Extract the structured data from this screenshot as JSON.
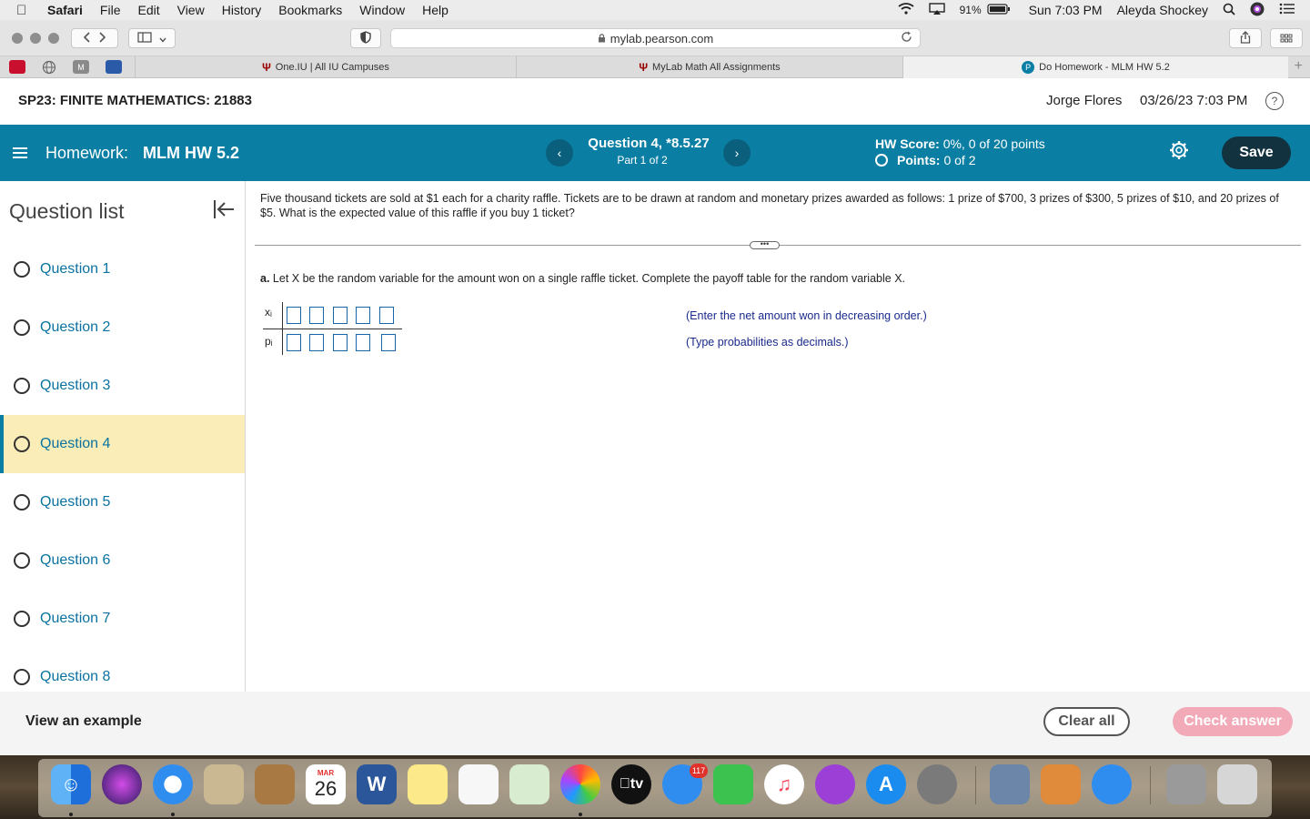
{
  "menubar": {
    "apple": "",
    "items": [
      "Safari",
      "File",
      "Edit",
      "View",
      "History",
      "Bookmarks",
      "Window",
      "Help"
    ],
    "battery": "91%",
    "clock": "Sun 7:03 PM",
    "user": "Aleyda Shockey"
  },
  "browser": {
    "url": "mylab.pearson.com",
    "tabs": [
      {
        "label": "One.IU | All IU Campuses",
        "icon": "Ψ"
      },
      {
        "label": "MyLab Math All Assignments",
        "icon": "Ψ"
      },
      {
        "label": "Do Homework - MLM HW 5.2",
        "icon": "P"
      }
    ],
    "bookmark_m": "M"
  },
  "course": {
    "title": "SP23: FINITE MATHEMATICS: 21883",
    "user": "Jorge Flores",
    "datetime": "03/26/23 7:03 PM",
    "help": "?"
  },
  "homework": {
    "label": "Homework:",
    "name": "MLM HW 5.2",
    "question_title": "Question 4, *8.5.27",
    "question_part": "Part 1 of 2",
    "score_label": "HW Score:",
    "score_value": "0%, 0 of 20 points",
    "points_label": "Points:",
    "points_value": "0 of 2",
    "save_label": "Save",
    "prev": "‹",
    "next": "›"
  },
  "sidebar": {
    "heading": "Question list",
    "items": [
      {
        "label": "Question 1"
      },
      {
        "label": "Question 2"
      },
      {
        "label": "Question 3"
      },
      {
        "label": "Question 4"
      },
      {
        "label": "Question 5"
      },
      {
        "label": "Question 6"
      },
      {
        "label": "Question 7"
      },
      {
        "label": "Question 8"
      }
    ],
    "active_index": 3
  },
  "problem": {
    "text": "Five thousand tickets are sold at $1 each for a charity raffle. Tickets are to be drawn at random and monetary prizes awarded as follows: 1 prize of $700, 3 prizes of $300, 5 prizes of $10, and 20 prizes of $5. What is the expected value of this raffle if you buy 1 ticket?",
    "part_label": "a.",
    "part_text": "Let X be the random variable for the amount won on a single raffle ticket. Complete the payoff table for the random variable X.",
    "row_x_label": "xᵢ",
    "row_p_label": "pᵢ",
    "hint_x": "(Enter the net amount won in decreasing order.)",
    "hint_p": "(Type probabilities as decimals.)",
    "ellipsis": "•••"
  },
  "actions": {
    "example": "View an example",
    "clear": "Clear all",
    "check": "Check answer"
  },
  "dock": {
    "calendar_month": "MAR",
    "calendar_day": "26",
    "messages_badge": "117",
    "tv_label": "tv"
  }
}
